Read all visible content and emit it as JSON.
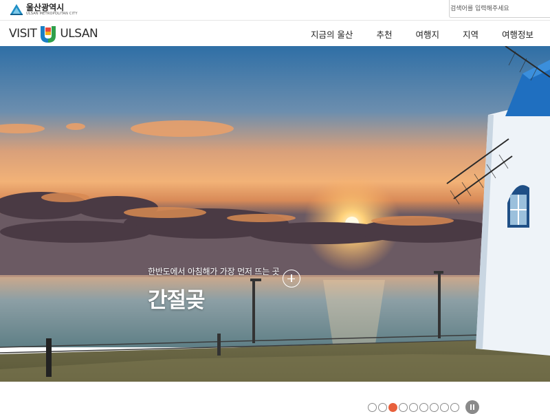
{
  "topbar": {
    "city_name": "울산광역시",
    "city_name_en": "ULSAN METROPOLITAN CITY",
    "search_placeholder": "검색어를 입력해주세요"
  },
  "brand": {
    "left": "VISIT",
    "right": "ULSAN",
    "logo_colors": [
      "#1a7fc4",
      "#e8463a",
      "#2fa04b",
      "#f5b21a"
    ]
  },
  "nav": {
    "items": [
      {
        "label": "지금의 울산"
      },
      {
        "label": "추천"
      },
      {
        "label": "여행지"
      },
      {
        "label": "지역"
      },
      {
        "label": "여행정보"
      }
    ]
  },
  "hero": {
    "subtitle": "한반도에서 아침해가 가장 먼저 뜨는 곳",
    "title": "간절곶",
    "more_icon": "plus-circle-icon"
  },
  "pager": {
    "slide_count": 9,
    "active_index": 2,
    "active_color": "#e8603c",
    "pause_icon": "pause-icon"
  }
}
